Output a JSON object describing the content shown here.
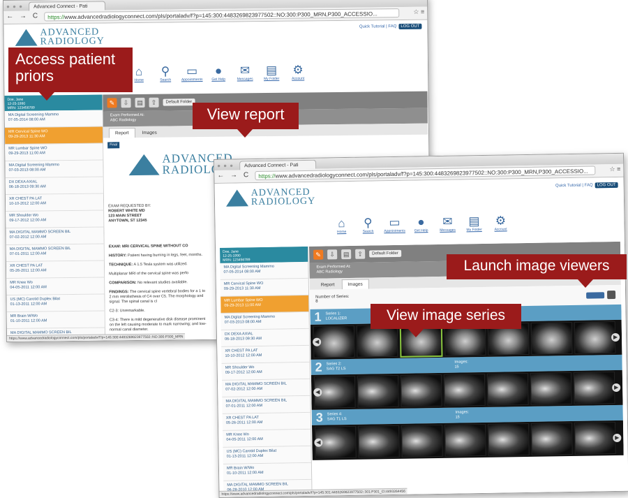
{
  "callouts": {
    "access_priors": "Access patient priors",
    "view_report": "View report",
    "launch_viewers": "Launch image viewers",
    "view_series": "View image series"
  },
  "browser": {
    "tab_title": "Advanced Connect - Pati",
    "url_https": "https://",
    "url_rest": "www.advancedradiologyconnect.com/pls/portaladv/f?p=145:300:4483269823977502::NO:300:P300_MRN,P300_ACCESSIO..."
  },
  "portal": {
    "logo_line1": "ADVANCED",
    "logo_line2": "RADIOLOGY",
    "quick_tutorial": "Quick Tutorial",
    "faq": "FAQ",
    "logout": "LOG OUT",
    "nav": [
      {
        "label": "Home",
        "icon": "home-icon",
        "glyph": "⌂"
      },
      {
        "label": "Search",
        "icon": "search-icon",
        "glyph": "⚲"
      },
      {
        "label": "Appointments",
        "icon": "calendar-icon",
        "glyph": "▭"
      },
      {
        "label": "Get Help",
        "icon": "help-icon",
        "glyph": "●"
      },
      {
        "label": "Messages",
        "icon": "messages-icon",
        "glyph": "✉"
      },
      {
        "label": "My Folder",
        "icon": "folder-icon",
        "glyph": "▤"
      },
      {
        "label": "Account",
        "icon": "gear-icon",
        "glyph": "⚙"
      }
    ]
  },
  "patient": {
    "name": "Doe, Jane",
    "dob": "12-25-1990",
    "mrn": "MRN: 123456789"
  },
  "exams": [
    {
      "title": "MA Digital Screening Mammo",
      "date": "07-05-2014 08:00 AM"
    },
    {
      "title": "MR Cervical Spine WO",
      "date": "09-29-2013 11:30 AM"
    },
    {
      "title": "MR Lumbar Spine WO",
      "date": "09-29-2013 11:00 AM"
    },
    {
      "title": "MA Digital Screening Mammo",
      "date": "07-03-2013 08:00 AM"
    },
    {
      "title": "DX DEXA AXIAL",
      "date": "06-18-2013 09:30 AM"
    },
    {
      "title": "XR CHEST PA LAT",
      "date": "10-10-2012 12:00 AM"
    },
    {
      "title": "MR Shoulder Wo",
      "date": "09-17-2012 12:00 AM"
    },
    {
      "title": "MA DIGITAL MAMMO SCREEN BIL",
      "date": "07-02-2012 12:00 AM"
    },
    {
      "title": "MA DIGITAL MAMMO SCREEN BIL",
      "date": "07-01-2011 12:00 AM"
    },
    {
      "title": "XR CHEST PA LAT",
      "date": "05-26-2011 12:00 AM"
    },
    {
      "title": "MR Knee Wo",
      "date": "04-05-2011 12:00 AM"
    },
    {
      "title": "US (MC) Carotid Duplex Bilat",
      "date": "01-13-2011 12:00 AM"
    },
    {
      "title": "MR Brain W/Wo",
      "date": "01-10-2011 12:00 AM"
    },
    {
      "title": "MA DIGITAL MAMMO SCREEN BIL",
      "date": "06-28-2010 12:00 AM"
    }
  ],
  "viewer": {
    "folder": "Default Folder",
    "exam_performed_at": "Exam Performed At:",
    "location": "ABC Radiology",
    "tab_report": "Report",
    "tab_images": "Images",
    "referrer_right": "WHITE MD",
    "number_of_series_label": "Number of Series:",
    "number_of_series": "8"
  },
  "report": {
    "final": "Final",
    "exam_requested_by": "EXAM REQUESTED BY:",
    "physician": "ROBERT WHITE MD",
    "street": "123 MAIN STREET",
    "city": "ANYTOWN, ST 12345",
    "exam_line": "EXAM: MRI CERVICAL SPINE WITHOUT CO",
    "history_label": "HISTORY:",
    "history_text": "Patient having burning in legs, feet, months.",
    "technique_label": "TECHNIQUE:",
    "technique_text": "A 1.5 Tesla system was utilized.",
    "multiplanar": "Multiplanar MRI of the cervical spine was perfo",
    "comparison_label": "COMPARISON:",
    "comparison_text": "No relevant studies available.",
    "findings_label": "FINDINGS:",
    "findings_text": "The cervical spine vertebral bodies for a 1 to 2 mm retrolisthesis of C4 over C5. The morphology and signal. The spinal canal is cl",
    "c23": "C2-3: Unremarkable.",
    "c34": "C3-4: There is mild degenerative disk disease prominent on the left causing moderate to mark narrowing; and low-normal canal diameter."
  },
  "series": [
    {
      "number": "1",
      "label": "Series 1:",
      "name": "LOCALIZER",
      "images_label": "",
      "images": ""
    },
    {
      "number": "2",
      "label": "Series 2:",
      "name": "SAG T2 LS",
      "images_label": "Images:",
      "images": "15"
    },
    {
      "number": "3",
      "label": "Series 4:",
      "name": "SAG T1 LS",
      "images_label": "Images:",
      "images": "15"
    }
  ],
  "status_url_1": "https://www.advancedradiologyconnect.com/pls/portaladv/f?p=145:300:4483269823977502::NO:300:P300_MRN",
  "status_url_2": "https://www.advancedradiologyconnect.com/pls/portaladv/f?p=145:301:4483269823977502::301:P301_CI:4493264456"
}
